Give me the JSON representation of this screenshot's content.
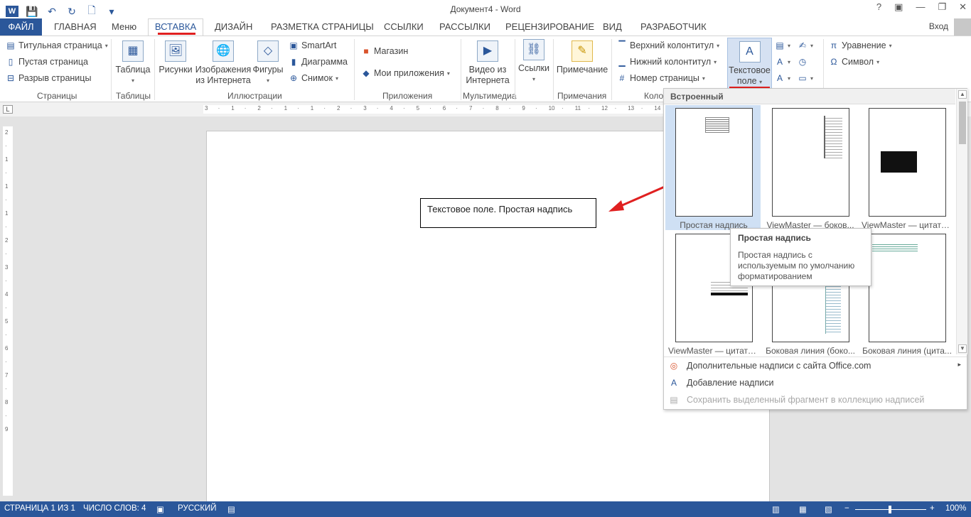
{
  "titlebar": {
    "title": "Документ4 - Word",
    "help": "?",
    "restore_ribbon": "▣",
    "minimize": "—",
    "maximize": "❐",
    "close": "✕"
  },
  "qat": {
    "word": "W",
    "save": "💾",
    "undo": "↶",
    "redo": "↻",
    "new": "🗋",
    "customize": "▾"
  },
  "tabs": {
    "file": "ФАЙЛ",
    "home": "ГЛАВНАЯ",
    "menu": "Меню",
    "insert": "ВСТАВКА",
    "design": "ДИЗАЙН",
    "layout": "РАЗМЕТКА СТРАНИЦЫ",
    "references": "ССЫЛКИ",
    "mailings": "РАССЫЛКИ",
    "review": "РЕЦЕНЗИРОВАНИЕ",
    "view": "ВИД",
    "developer": "РАЗРАБОТЧИК",
    "login": "Вход"
  },
  "ribbon": {
    "pages": {
      "cover": "Титульная страница",
      "blank": "Пустая страница",
      "break": "Разрыв страницы",
      "label": "Страницы"
    },
    "tables": {
      "table": "Таблица",
      "label": "Таблицы"
    },
    "illustrations": {
      "pictures": "Рисунки",
      "online_line1": "Изображения",
      "online_line2": "из Интернета",
      "shapes": "Фигуры",
      "smartart": "SmartArt",
      "chart": "Диаграмма",
      "screenshot": "Снимок",
      "label": "Иллюстрации"
    },
    "apps": {
      "store": "Магазин",
      "my_apps": "Мои приложения",
      "label": "Приложения"
    },
    "media": {
      "video_line1": "Видео из",
      "video_line2": "Интернета",
      "label": "Мультимедиа"
    },
    "links": {
      "links": "Ссылки"
    },
    "comments": {
      "comment": "Примечание",
      "label": "Примечания"
    },
    "headerfooter": {
      "header": "Верхний колонтитул",
      "footer": "Нижний колонтитул",
      "page_number": "Номер страницы",
      "label": "Коло"
    },
    "text": {
      "textbox_line1": "Текстовое",
      "textbox_line2": "поле"
    },
    "symbols": {
      "equation": "Уравнение",
      "symbol": "Символ"
    }
  },
  "ruler": {
    "marks": [
      "3",
      "·",
      "1",
      "·",
      "2",
      "·",
      "1",
      "·",
      "1",
      "·",
      "2",
      "·",
      "3",
      "·",
      "4",
      "·",
      "5",
      "·",
      "6",
      "·",
      "7",
      "·",
      "8",
      "·",
      "9",
      "·",
      "10",
      "·",
      "11",
      "·",
      "12",
      "·",
      "13",
      "·",
      "14"
    ]
  },
  "vruler": {
    "marks": [
      "2",
      "·",
      "1",
      "·",
      "1",
      "·",
      "1",
      "·",
      "2",
      "·",
      "3",
      "·",
      "4",
      "·",
      "5",
      "·",
      "6",
      "·",
      "7",
      "·",
      "8",
      "·",
      "9"
    ]
  },
  "document": {
    "textbox_text": "Текстовое поле. Простая надпись"
  },
  "gallery": {
    "heading": "Встроенный",
    "items": [
      {
        "label": "Простая надпись"
      },
      {
        "label": "ViewMaster — боков..."
      },
      {
        "label": "ViewMaster — цитата..."
      },
      {
        "label": "ViewMaster — цитата..."
      },
      {
        "label": "Боковая линия (боко..."
      },
      {
        "label": "Боковая линия (цита..."
      }
    ],
    "menu": {
      "more": "Дополнительные надписи с сайта Office.com",
      "draw": "Добавление надписи",
      "save": "Сохранить выделенный фрагмент в коллекцию надписей"
    }
  },
  "tooltip": {
    "title": "Простая надпись",
    "body": "Простая надпись с используемым по умолчанию форматированием"
  },
  "status": {
    "page": "СТРАНИЦА 1 ИЗ 1",
    "words": "ЧИСЛО СЛОВ: 4",
    "lang": "РУССКИЙ",
    "zoom": "100%",
    "zoom_out": "−",
    "zoom_in": "+"
  },
  "colors": {
    "accent": "#2b579a",
    "highlight_line": "#e02020"
  }
}
